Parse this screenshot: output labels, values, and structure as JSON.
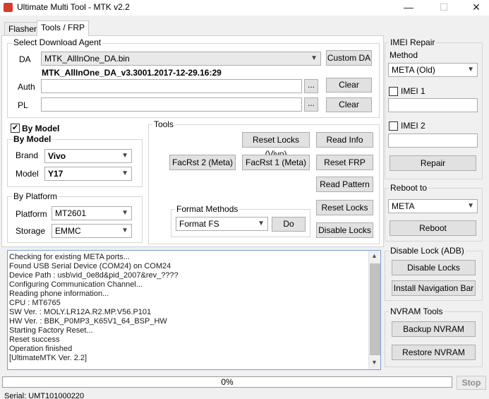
{
  "window": {
    "title": "Ultimate Multi Tool - MTK v2.2",
    "min": "—",
    "max": "☐",
    "close": "✕"
  },
  "tabs": [
    {
      "label": "Flasher"
    },
    {
      "label": "Tools / FRP"
    }
  ],
  "download_agent": {
    "legend": "Select Download Agent",
    "da_label": "DA",
    "da_value": "MTK_AllInOne_DA.bin",
    "custom_da": "Custom DA",
    "da_version": "MTK_AllInOne_DA_v3.3001.2017-12-29.16:29",
    "auth_label": "Auth",
    "auth_value": "",
    "auth_browse": "...",
    "auth_clear": "Clear",
    "pl_label": "PL",
    "pl_value": "",
    "pl_browse": "...",
    "pl_clear": "Clear"
  },
  "by_model": {
    "checkbox_label": "By Model",
    "checked": true,
    "legend": "By Model",
    "brand_label": "Brand",
    "brand_value": "Vivo",
    "model_label": "Model",
    "model_value": "Y17"
  },
  "by_platform": {
    "legend": "By Platform",
    "platform_label": "Platform",
    "platform_value": "MT2601",
    "storage_label": "Storage",
    "storage_value": "EMMC"
  },
  "tools": {
    "legend": "Tools",
    "reset_locks_vivo": "Reset Locks (Vivo)",
    "read_info": "Read Info",
    "facrst2": "FacRst 2 (Meta)",
    "facrst1": "FacRst 1 (Meta)",
    "reset_frp": "Reset FRP",
    "read_pattern": "Read Pattern",
    "reset_locks": "Reset Locks",
    "disable_locks": "Disable Locks",
    "format_legend": "Format Methods",
    "format_value": "Format FS",
    "do": "Do"
  },
  "imei_repair": {
    "legend": "IMEI Repair",
    "method_label": "Method",
    "method_value": "META (Old)",
    "imei1_label": "IMEI 1",
    "imei1_value": "",
    "imei2_label": "IMEI 2",
    "imei2_value": "",
    "repair": "Repair"
  },
  "reboot": {
    "legend": "Reboot to",
    "value": "META",
    "button": "Reboot"
  },
  "disable_lock_adb": {
    "legend": "Disable Lock (ADB)",
    "disable_locks": "Disable Locks",
    "install_nav": "Install Navigation Bar"
  },
  "nvram": {
    "legend": "NVRAM Tools",
    "backup": "Backup NVRAM",
    "restore": "Restore NVRAM"
  },
  "log": [
    "Checking for existing META ports...",
    "Found USB Serial Device (COM24) on COM24",
    "Device Path : usb\\vid_0e8d&pid_2007&rev_????",
    "Configuring Communication Channel...",
    "Reading phone information...",
    "CPU : MT6765",
    "SW Ver. : MOLY.LR12A.R2.MP.V56.P101",
    "HW Ver. : BBK_P0MP3_K65V1_64_BSP_HW",
    "Starting Factory Reset...",
    "Reset success",
    "Operation finished",
    "[UltimateMTK Ver. 2.2]"
  ],
  "progress": {
    "percent": 0,
    "text": "0%"
  },
  "stop": "Stop",
  "status": "Serial: UMT101000220",
  "icons": {
    "app": "app-icon",
    "dropdown": "chevron-down-icon",
    "check": "checkmark-icon"
  },
  "colors": {
    "progress_fill": "#06b025",
    "log_border": "#7a9cd3",
    "app_icon": "#d83b2b"
  }
}
